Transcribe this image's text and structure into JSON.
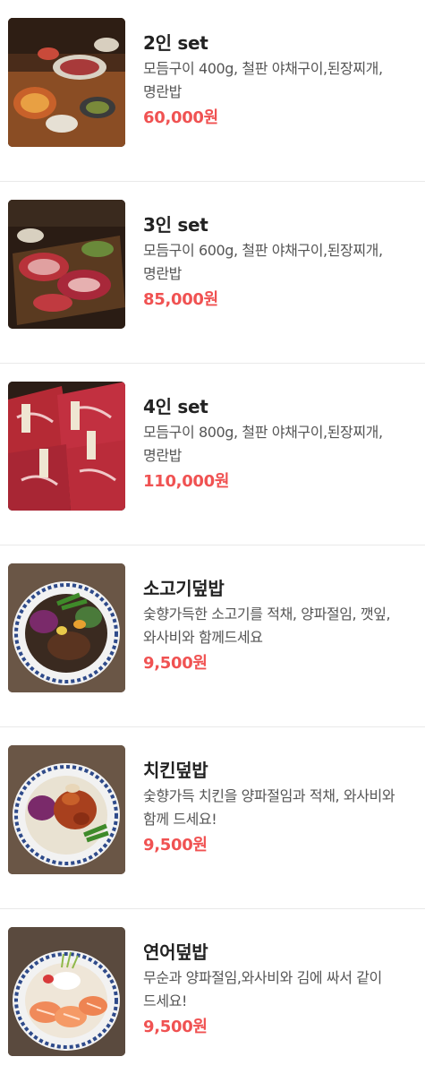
{
  "menu": {
    "items": [
      {
        "name": "2인 set",
        "description": "모듬구이 400g, 철판 야채구이,된장찌개,명란밥",
        "price": "60,000원",
        "image_icon": "bbq-set-table-photo"
      },
      {
        "name": "3인 set",
        "description": "모듬구이 600g, 철판 야채구이,된장찌개,명란밥",
        "price": "85,000원",
        "image_icon": "raw-beef-platter-photo"
      },
      {
        "name": "4인 set",
        "description": "모듬구이 800g, 철판 야채구이,된장찌개,명란밥",
        "price": "110,000원",
        "image_icon": "marbled-beef-cuts-photo"
      },
      {
        "name": "소고기덮밥",
        "description": "숯향가득한 소고기를 적채, 양파절임, 깻잎, 와사비와 함께드세요",
        "price": "9,500원",
        "image_icon": "beef-rice-bowl-photo"
      },
      {
        "name": "치킨덮밥",
        "description": "숯향가득 치킨을 양파절임과 적채, 와사비와 함께 드세요!",
        "price": "9,500원",
        "image_icon": "chicken-rice-bowl-photo"
      },
      {
        "name": "연어덮밥",
        "description": "무순과 양파절임,와사비와 김에 싸서 같이 드세요!",
        "price": "9,500원",
        "image_icon": "salmon-rice-bowl-photo"
      }
    ]
  }
}
